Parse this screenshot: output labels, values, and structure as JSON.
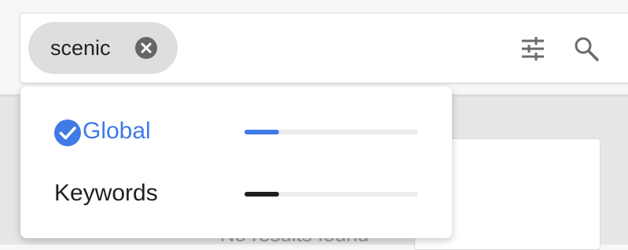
{
  "search": {
    "chip_label": "scenic",
    "icons": {
      "remove": "close-circle-icon",
      "filter": "tune-sliders-icon",
      "search": "magnifier-icon"
    }
  },
  "dropdown": {
    "options": [
      {
        "label": "Global",
        "selected": true,
        "level": 0.2,
        "color": "#3f7ae6"
      },
      {
        "label": "Keywords",
        "selected": false,
        "level": 0.2,
        "color": "#1f1f1f"
      }
    ]
  },
  "results": {
    "empty_text": "No results found"
  },
  "colors": {
    "accent": "#3f7ae6",
    "chip_bg": "#dedede"
  }
}
